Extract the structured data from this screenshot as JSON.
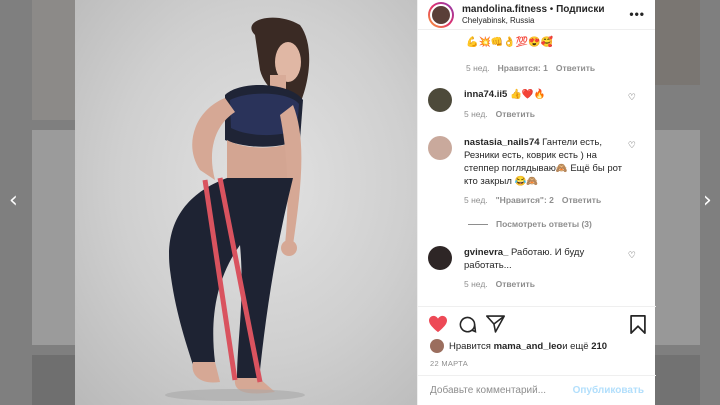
{
  "header": {
    "username": "mandolina.fitness",
    "separator": " • ",
    "follow_label": "Подписки",
    "location": "Chelyabinsk, Russia",
    "more_icon": "more-dots-icon"
  },
  "comments": {
    "first": {
      "emoji_text": "💪💥👊👌💯😍🥰",
      "time": "5 нед.",
      "likes": "Нравится: 1",
      "reply": "Ответить"
    },
    "items": [
      {
        "username": "inna74.ii5",
        "text": "👍❤️🔥",
        "time": "5 нед.",
        "likes": "",
        "reply": "Ответить"
      },
      {
        "username": "nastasia_nails74",
        "text": "Гантели есть, Резники есть, коврик есть ) на степпер поглядываю🙈 Ещё бы рот кто закрыл 😂🙈",
        "time": "5 нед.",
        "likes": "\"Нравится\": 2",
        "reply": "Ответить"
      },
      {
        "username": "gvinevra_",
        "text": "Работаю. И буду работать...",
        "time": "5 нед.",
        "likes": "",
        "reply": "Ответить"
      }
    ],
    "view_replies": "Посмотреть ответы (3)"
  },
  "likes": {
    "prefix": "Нравится ",
    "user": "mama_and_leo",
    "suffix": " и ещё ",
    "count": "210"
  },
  "date": "22 МАРТА",
  "composer": {
    "placeholder": "Добавьте комментарий...",
    "post_label": "Опубликовать"
  },
  "colors": {
    "like_red": "#ed4956",
    "post_disabled": "#b2dffc",
    "meta_gray": "#8e8e8e"
  }
}
